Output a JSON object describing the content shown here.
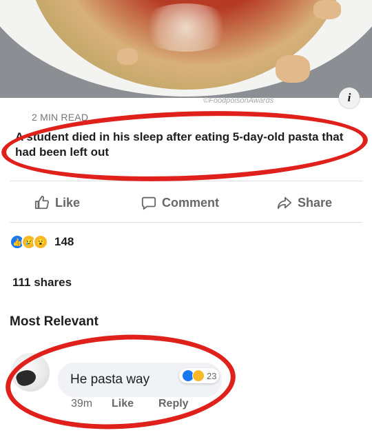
{
  "post": {
    "watermark": "©FoodpoisonAwards",
    "info_symbol": "i",
    "meta": "2 MIN READ",
    "headline": "A student died in his sleep after eating 5-day-old pasta that had been left out"
  },
  "actions": {
    "like": "Like",
    "comment": "Comment",
    "share": "Share"
  },
  "reactions": {
    "count": "148",
    "icons": [
      "like-icon",
      "sad-icon",
      "wow-icon"
    ]
  },
  "shares": "111 shares",
  "comments": {
    "filter_label": "Most Relevant",
    "items": [
      {
        "text": "He pasta way",
        "reaction_count": "23",
        "time": "39m",
        "like": "Like",
        "reply": "Reply"
      }
    ]
  },
  "colors": {
    "highlight_ring": "#e0201b",
    "like_blue": "#1877f2",
    "action_gray": "#65676b"
  }
}
